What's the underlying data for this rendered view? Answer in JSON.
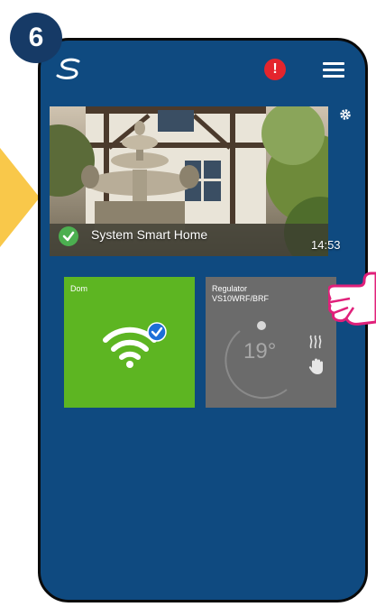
{
  "step": {
    "number": "6"
  },
  "header": {
    "logo_icon": "swirl-logo-icon",
    "alert_symbol": "!",
    "menu_icon": "hamburger-menu-icon"
  },
  "home": {
    "name": "System Smart Home",
    "time": "14:53",
    "status_icon": "check-circle-icon",
    "settings_icon": "gear-icon"
  },
  "tiles": [
    {
      "label": "Dom",
      "icon": "wifi-icon",
      "badge_icon": "check-badge-icon",
      "color": "#5db522"
    },
    {
      "label": "Regulator",
      "sublabel": "VS10WRF/BRF",
      "temperature": "19°",
      "icons": [
        "heating-icon",
        "manual-hand-icon"
      ],
      "color": "#6b6b6b"
    }
  ],
  "colors": {
    "screen": "#0f4a80",
    "badge": "#163a66",
    "accent_arrow": "#f9c84a",
    "alert": "#e4252d",
    "pointer": "#e0207a"
  }
}
